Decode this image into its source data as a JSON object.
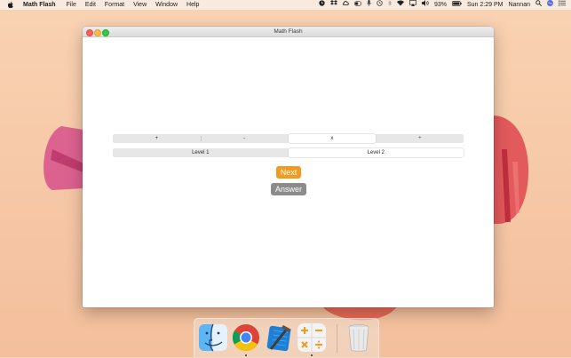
{
  "menubar": {
    "app_name": "Math Flash",
    "menus": [
      "File",
      "Edit",
      "Format",
      "View",
      "Window",
      "Help"
    ],
    "status": {
      "battery": "93%",
      "clock": "Sun 2:29 PM",
      "user": "Nannan"
    },
    "icons": [
      "apple-icon",
      "clock-icon",
      "dropbox-icon",
      "creative-cloud-icon",
      "toggle-icon",
      "microphone-icon",
      "time-machine-icon",
      "bluetooth-icon",
      "wifi-icon",
      "airplay-icon",
      "volume-icon",
      "battery-icon",
      "search-icon",
      "siri-icon",
      "notification-center-icon"
    ]
  },
  "window": {
    "title": "Math Flash",
    "operations": {
      "options": [
        "+",
        "-",
        "x",
        "÷"
      ],
      "selected": "x"
    },
    "levels": {
      "options": [
        "Level 1",
        "Level 2"
      ],
      "selected": "Level 2"
    },
    "next_label": "Next",
    "answer_label": "Answer"
  },
  "dock": {
    "apps": [
      "Finder",
      "Google Chrome",
      "Xcode",
      "Calculator",
      "Trash"
    ],
    "running": [
      "Google Chrome",
      "Calculator"
    ]
  },
  "colors": {
    "next_button": "#f29a1d",
    "answer_button": "#8b8b8b",
    "wallpaper": "#f6c7a6"
  }
}
